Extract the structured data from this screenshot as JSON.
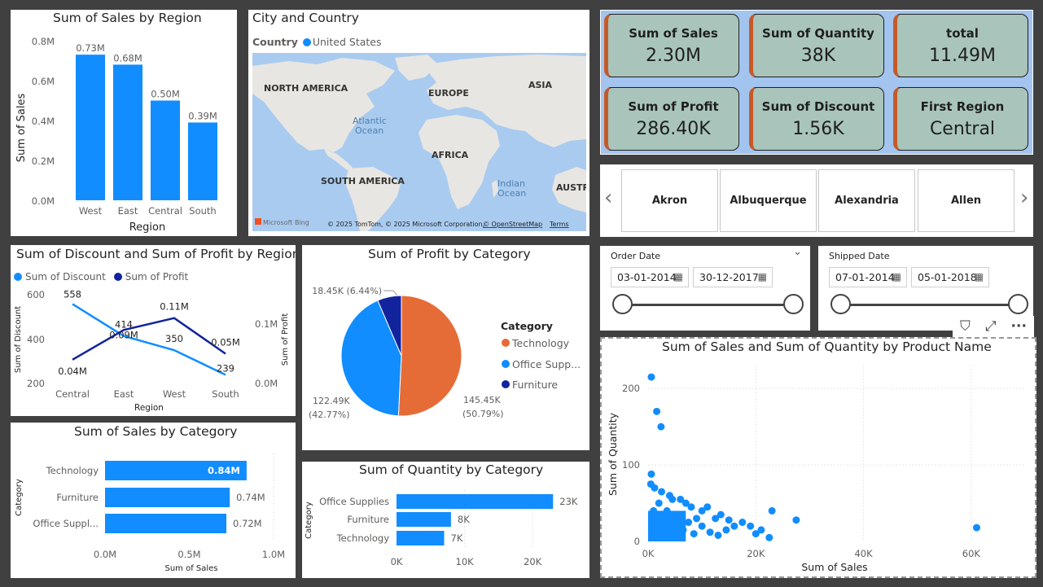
{
  "colors": {
    "blue": "#118dff",
    "navy": "#12239e",
    "orange": "#e66c37",
    "kpi_bg": "#a9c5bb",
    "kpi_border_accent": "#c55a28",
    "slicer_bg": "#a3c4ee"
  },
  "sales_region": {
    "title": "Sum of Sales by Region",
    "ylabel": "Sum of Sales",
    "xlabel": "Region",
    "yticks": [
      "0.8M",
      "0.6M",
      "0.4M",
      "0.2M",
      "0.0M"
    ]
  },
  "map": {
    "title": "City and Country",
    "legend_label": "Country",
    "legend_item": "United States",
    "labels": {
      "na": "NORTH AMERICA",
      "europe": "EUROPE",
      "asia": "ASIA",
      "atlantic1": "Atlantic",
      "atlantic2": "Ocean",
      "africa": "AFRICA",
      "sa": "SOUTH AMERICA",
      "indian1": "Indian",
      "indian2": "Ocean",
      "austr": "AUSTR"
    },
    "bing": "Microsoft Bing",
    "attribution": "© 2025 TomTom, © 2025 Microsoft Corporation,",
    "osm": "© OpenStreetMap",
    "terms": "Terms"
  },
  "kpis": [
    {
      "label": "Sum of Sales",
      "value": "2.30M"
    },
    {
      "label": "Sum of Quantity",
      "value": "38K"
    },
    {
      "label": "total",
      "value": "11.49M"
    },
    {
      "label": "Sum of Profit",
      "value": "286.40K"
    },
    {
      "label": "Sum of Discount",
      "value": "1.56K"
    },
    {
      "label": "First Region",
      "value": "Central"
    }
  ],
  "cities": {
    "prev": "‹",
    "next": "›",
    "items": [
      "Akron",
      "Albuquerque",
      "Alexandria",
      "Allen"
    ]
  },
  "discount_profit": {
    "title": "Sum of Discount and Sum of Profit by Region",
    "legend": [
      "Sum of Discount",
      "Sum of Profit"
    ],
    "y1label": "Sum of Discount",
    "y2label": "Sum of Profit",
    "xlabel": "Region",
    "y1ticks": [
      "600",
      "400",
      "200"
    ],
    "y2ticks": [
      "0.1M",
      "0.0M"
    ],
    "discount_labels": [
      "558",
      "414",
      "350",
      "239"
    ],
    "profit_labels": [
      "0.04M",
      "0.09M",
      "0.11M",
      "0.05M"
    ]
  },
  "profit_category": {
    "title": "Sum of Profit by Category",
    "legend_title": "Category",
    "legend": [
      "Technology",
      "Office Supp...",
      "Furniture"
    ],
    "label_furn": "18.45K (6.44%)",
    "label_off1": "122.49K",
    "label_off2": "(42.77%)",
    "label_tech1": "145.45K",
    "label_tech2": "(50.79%)"
  },
  "order_date": {
    "title": "Order Date",
    "from": "03-01-2014",
    "to": "30-12-2017",
    "chevron": "⌄"
  },
  "shipped_date": {
    "title": "Shipped Date",
    "from": "07-01-2014",
    "to": "05-01-2018"
  },
  "cal_icon": "▦",
  "visual_header": {
    "filter": "⛉",
    "focus": "⤢",
    "more": "···"
  },
  "sales_category": {
    "title": "Sum of Sales by Category",
    "ylabel": "Category",
    "xlabel": "Sum of Sales",
    "xticks": [
      "0.0M",
      "0.5M",
      "1.0M"
    ]
  },
  "quantity_category": {
    "title": "Sum of Quantity by Category",
    "ylabel": "Category",
    "xticks": [
      "0K",
      "10K",
      "20K"
    ]
  },
  "scatter": {
    "title": "Sum of Sales and Sum of Quantity by Product Name",
    "xlabel": "Sum of Sales",
    "ylabel": "Sum of Quantity",
    "xticks": [
      "0K",
      "20K",
      "40K",
      "60K"
    ],
    "yticks": [
      "200",
      "100",
      "0"
    ]
  },
  "chart_data": [
    {
      "type": "bar",
      "title": "Sum of Sales by Region",
      "categories": [
        "West",
        "East",
        "Central",
        "South"
      ],
      "values": [
        0.73,
        0.68,
        0.5,
        0.39
      ],
      "value_labels": [
        "0.73M",
        "0.68M",
        "0.50M",
        "0.39M"
      ],
      "unit": "M",
      "xlabel": "Region",
      "ylabel": "Sum of Sales",
      "ylim": [
        0,
        0.8
      ]
    },
    {
      "type": "line",
      "title": "Sum of Discount and Sum of Profit by Region",
      "categories": [
        "Central",
        "East",
        "West",
        "South"
      ],
      "series": [
        {
          "name": "Sum of Discount",
          "values": [
            558,
            414,
            350,
            239
          ],
          "axis": "left"
        },
        {
          "name": "Sum of Profit",
          "values": [
            0.04,
            0.09,
            0.11,
            0.05
          ],
          "axis": "right",
          "unit": "M"
        }
      ],
      "xlabel": "Region",
      "y1lim": [
        200,
        600
      ],
      "y2lim": [
        0,
        0.1
      ]
    },
    {
      "type": "pie",
      "title": "Sum of Profit by Category",
      "categories": [
        "Technology",
        "Office Supplies",
        "Furniture"
      ],
      "values": [
        145.45,
        122.49,
        18.45
      ],
      "percent": [
        50.79,
        42.77,
        6.44
      ],
      "unit": "K"
    },
    {
      "type": "bar",
      "orientation": "horizontal",
      "title": "Sum of Sales by Category",
      "categories": [
        "Technology",
        "Furniture",
        "Office Suppl..."
      ],
      "values": [
        0.84,
        0.74,
        0.72
      ],
      "value_labels": [
        "0.84M",
        "0.74M",
        "0.72M"
      ],
      "unit": "M",
      "xlim": [
        0,
        1.0
      ]
    },
    {
      "type": "bar",
      "orientation": "horizontal",
      "title": "Sum of Quantity by Category",
      "categories": [
        "Office Supplies",
        "Furniture",
        "Technology"
      ],
      "values": [
        23,
        8,
        7
      ],
      "value_labels": [
        "23K",
        "8K",
        "7K"
      ],
      "unit": "K",
      "xlim": [
        0,
        25
      ]
    },
    {
      "type": "scatter",
      "title": "Sum of Sales and Sum of Quantity by Product Name",
      "xlabel": "Sum of Sales",
      "ylabel": "Sum of Quantity",
      "xlim": [
        0,
        70000
      ],
      "ylim": [
        0,
        230
      ],
      "points": [
        [
          600,
          215
        ],
        [
          1600,
          170
        ],
        [
          2400,
          150
        ],
        [
          600,
          88
        ],
        [
          500,
          75
        ],
        [
          1200,
          70
        ],
        [
          2500,
          65
        ],
        [
          4000,
          60
        ],
        [
          4500,
          55
        ],
        [
          6000,
          55
        ],
        [
          7000,
          50
        ],
        [
          8000,
          45
        ],
        [
          10000,
          40
        ],
        [
          11000,
          45
        ],
        [
          12500,
          30
        ],
        [
          13500,
          35
        ],
        [
          15000,
          28
        ],
        [
          16000,
          20
        ],
        [
          17500,
          25
        ],
        [
          19000,
          20
        ],
        [
          20000,
          10
        ],
        [
          21000,
          15
        ],
        [
          23000,
          40
        ],
        [
          27500,
          28
        ],
        [
          22500,
          5
        ],
        [
          61000,
          18
        ],
        [
          9000,
          30
        ],
        [
          7500,
          25
        ],
        [
          5500,
          35
        ],
        [
          3500,
          40
        ],
        [
          3000,
          30
        ],
        [
          2000,
          50
        ],
        [
          1000,
          40
        ],
        [
          800,
          30
        ],
        [
          1500,
          20
        ],
        [
          2500,
          15
        ],
        [
          4000,
          10
        ],
        [
          5000,
          20
        ],
        [
          6500,
          15
        ],
        [
          8500,
          10
        ],
        [
          10000,
          20
        ],
        [
          11500,
          12
        ],
        [
          13000,
          8
        ],
        [
          14500,
          15
        ],
        [
          3000,
          5
        ],
        [
          1500,
          8
        ]
      ]
    }
  ]
}
